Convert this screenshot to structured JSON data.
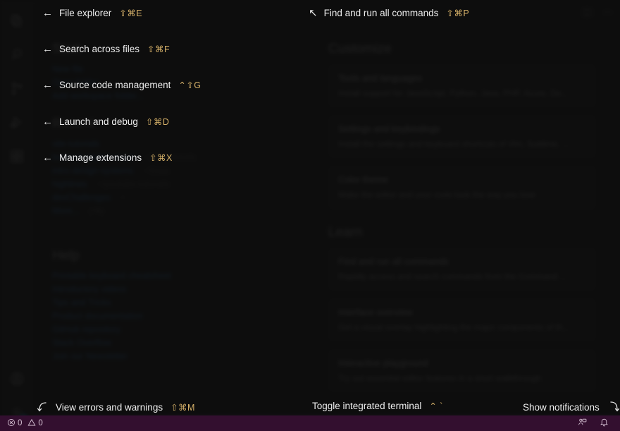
{
  "window": {
    "theme_background": "#141414",
    "statusbar_color": "#68217A",
    "accent_keys_color": "#d6b169"
  },
  "activity_bar": {
    "items": [
      {
        "name": "explorer",
        "icon": "files-icon",
        "tooltip": "Explorer"
      },
      {
        "name": "search",
        "icon": "search-icon",
        "tooltip": "Search"
      },
      {
        "name": "source-control",
        "icon": "source-control-icon",
        "tooltip": "Source Control"
      },
      {
        "name": "run-debug",
        "icon": "run-and-debug-icon",
        "tooltip": "Run and Debug"
      },
      {
        "name": "extensions",
        "icon": "extensions-icon",
        "tooltip": "Extensions"
      }
    ],
    "bottom_items": [
      {
        "name": "accounts",
        "icon": "account-icon",
        "tooltip": "Accounts"
      },
      {
        "name": "settings",
        "icon": "gear-icon",
        "tooltip": "Manage",
        "badge": "clock-badge"
      }
    ]
  },
  "welcome": {
    "start": {
      "heading": "Start",
      "links": [
        "New file",
        "Open folder...",
        "Add workspace folder..."
      ]
    },
    "recent": {
      "heading": "Recent",
      "items": [
        {
          "name": "site-tutorials",
          "path": ""
        },
        {
          "name": "bedrock-starter-react",
          "path": "~/Documents"
        },
        {
          "name": "intro-design-systems",
          "path": "~/Data"
        },
        {
          "name": "highlines",
          "path": "~/youtube-tutorials"
        },
        {
          "name": "devChallenges",
          "path": "~"
        }
      ],
      "more_label": "More...",
      "more_keys": "(^R)"
    },
    "help": {
      "heading": "Help",
      "links": [
        "Printable keyboard cheatsheet",
        "Introductory videos",
        "Tips and Tricks",
        "Product documentation",
        "GitHub repository",
        "Stack Overflow",
        "Join our Newsletter"
      ]
    },
    "customize": {
      "heading": "Customize",
      "cards": [
        {
          "title": "Tools and languages",
          "desc_prefix": "Install support for ",
          "desc_plain": "JavaScript, ",
          "desc_links": "Python, Java, PHP, Azure, Do...",
          "desc": "Install support for JavaScript, Python, Java, PHP, Azure, Do..."
        },
        {
          "title": "Settings and keybindings",
          "desc": "Install the settings and keyboard shortcuts of Vim, Sublime, ..."
        },
        {
          "title": "Color theme",
          "desc": "Make the editor and your code look the way you love"
        }
      ]
    },
    "learn": {
      "heading": "Learn",
      "cards": [
        {
          "title": "Find and run all commands",
          "desc": "Rapidly access and search commands from the Command ..."
        },
        {
          "title": "Interface overview",
          "desc": "Get a visual overlay highlighting the major components of th..."
        },
        {
          "title": "Interactive playground",
          "desc": "Try out essential editor features in a short walkthrough"
        }
      ]
    }
  },
  "overlay_callouts": [
    {
      "id": "file-explorer",
      "arrow": "←",
      "arrow_pos": "before",
      "label": "File explorer",
      "keys": "⇧⌘E"
    },
    {
      "id": "find-and-run-all-commands",
      "arrow": "↖",
      "arrow_pos": "before",
      "label": "Find and run all commands",
      "keys": "⇧⌘P"
    },
    {
      "id": "search-across-files",
      "arrow": "←",
      "arrow_pos": "before",
      "label": "Search across files",
      "keys": "⇧⌘F"
    },
    {
      "id": "source-code-management",
      "arrow": "←",
      "arrow_pos": "before",
      "label": "Source code management",
      "keys": "⌃⇧G"
    },
    {
      "id": "launch-and-debug",
      "arrow": "←",
      "arrow_pos": "before",
      "label": "Launch and debug",
      "keys": "⇧⌘D"
    },
    {
      "id": "manage-extensions",
      "arrow": "←",
      "arrow_pos": "before",
      "label": "Manage extensions",
      "keys": "⇧⌘X"
    },
    {
      "id": "view-errors-and-warnings",
      "arrow": "↵",
      "arrow_pos": "before",
      "label": "View errors and warnings",
      "keys": "⇧⌘M"
    },
    {
      "id": "toggle-integrated-terminal",
      "arrow": "",
      "arrow_pos": "none",
      "label": "Toggle integrated terminal",
      "keys": "⌃ `"
    },
    {
      "id": "show-notifications",
      "arrow": "⤵",
      "arrow_pos": "after",
      "label": "Show notifications",
      "keys": ""
    }
  ],
  "status_bar": {
    "errors_icon": "error-circle-icon",
    "errors_count": "0",
    "warnings_icon": "warning-triangle-icon",
    "warnings_count": "0",
    "remote_icon": "remote-indicator-icon",
    "notifications_icon": "bell-icon"
  }
}
